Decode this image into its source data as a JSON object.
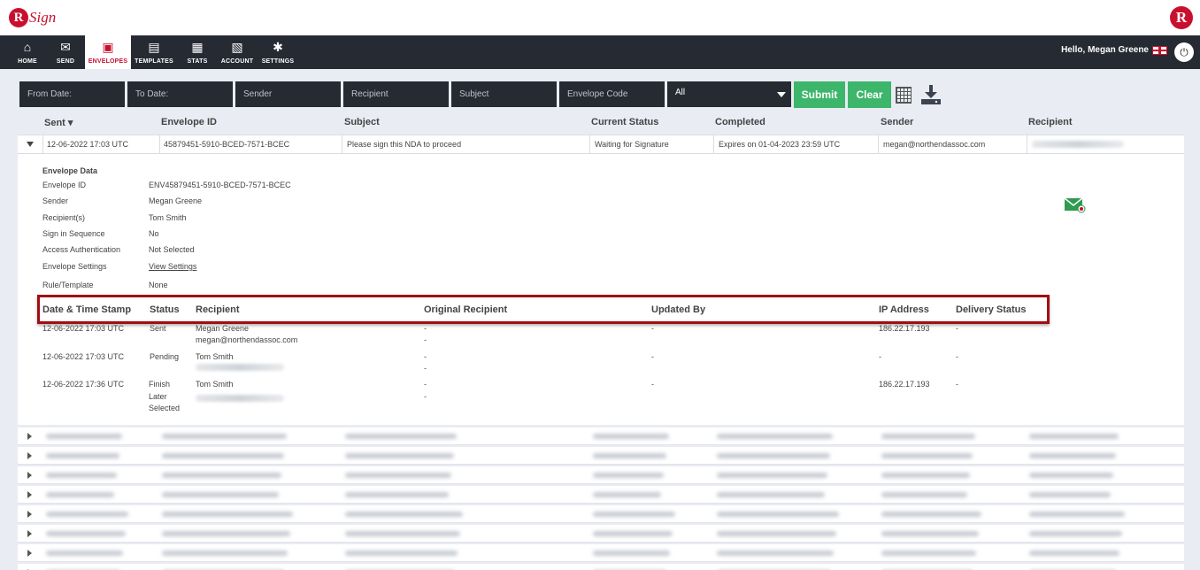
{
  "brand": {
    "logo_letter": "R",
    "logo_text": "Sign",
    "right_logo_letter": "R"
  },
  "nav": {
    "items": [
      {
        "label": "HOME",
        "icon": "⌂"
      },
      {
        "label": "SEND",
        "icon": "✉"
      },
      {
        "label": "ENVELOPES",
        "icon": "▣"
      },
      {
        "label": "TEMPLATES",
        "icon": "▤"
      },
      {
        "label": "STATS",
        "icon": "▦"
      },
      {
        "label": "ACCOUNT",
        "icon": "▧"
      },
      {
        "label": "SETTINGS",
        "icon": "✱"
      }
    ],
    "active": "ENVELOPES",
    "greeting": "Hello, Megan Greene",
    "power_icon": "⏻"
  },
  "filters": {
    "from_date": "From Date:",
    "to_date": "To Date:",
    "sender": "Sender",
    "recipient": "Recipient",
    "subject": "Subject",
    "envelope_code": "Envelope Code",
    "status_select": "All",
    "submit": "Submit",
    "clear": "Clear"
  },
  "table": {
    "headers": [
      "Sent",
      "Envelope ID",
      "Subject",
      "Current Status",
      "Completed",
      "Sender",
      "Recipient"
    ],
    "expanded_row": {
      "sent": "12-06-2022 17:03 UTC",
      "envelope_id": "45879451-5910-BCED-7571-BCEC",
      "subject": "Please sign this NDA to proceed",
      "status": "Waiting for Signature",
      "completed": "Expires on 01-04-2023 23:59 UTC",
      "sender": "megan@northendassoc.com"
    }
  },
  "envelope_data": {
    "title": "Envelope Data",
    "fields": [
      {
        "label": "Envelope ID",
        "value": "ENV45879451-5910-BCED-7571-BCEC"
      },
      {
        "label": "Sender",
        "value": "Megan Greene"
      },
      {
        "label": "Recipient(s)",
        "value": "Tom Smith"
      },
      {
        "label": "Sign in Sequence",
        "value": "No"
      },
      {
        "label": "Access Authentication",
        "value": "Not Selected"
      },
      {
        "label": "Envelope Settings",
        "value": "View Settings"
      },
      {
        "label": "Rule/Template",
        "value": "None"
      }
    ]
  },
  "history": {
    "headers": [
      "Date & Time Stamp",
      "Status",
      "Recipient",
      "Original Recipient",
      "Updated By",
      "IP Address",
      "Delivery Status"
    ],
    "rows": [
      {
        "ts": "12-06-2022 17:03 UTC",
        "status": "Sent",
        "recipient": "Megan Greene",
        "recipient_email": "megan@northendassoc.com",
        "orig1": "-",
        "orig2": "-",
        "updated": "-",
        "ip": "186.22.17.193",
        "delivery": "-"
      },
      {
        "ts": "12-06-2022 17:03 UTC",
        "status": "Pending",
        "recipient": "Tom Smith",
        "orig1": "-",
        "orig2": "-",
        "updated": "-",
        "ip": "-",
        "delivery": "-"
      },
      {
        "ts": "12-06-2022 17:36 UTC",
        "status1": "Finish",
        "status2": "Later",
        "status3": "Selected",
        "recipient": "Tom Smith",
        "orig1": "-",
        "orig2": "-",
        "updated": "-",
        "ip": "186.22.17.193",
        "delivery": "-"
      }
    ]
  },
  "colors": {
    "nav_bg": "#252a33",
    "brand_red": "#c8102e",
    "accent_green": "#3db66b",
    "highlight_red": "#a30d12",
    "content_bg": "#e9ecf2"
  }
}
